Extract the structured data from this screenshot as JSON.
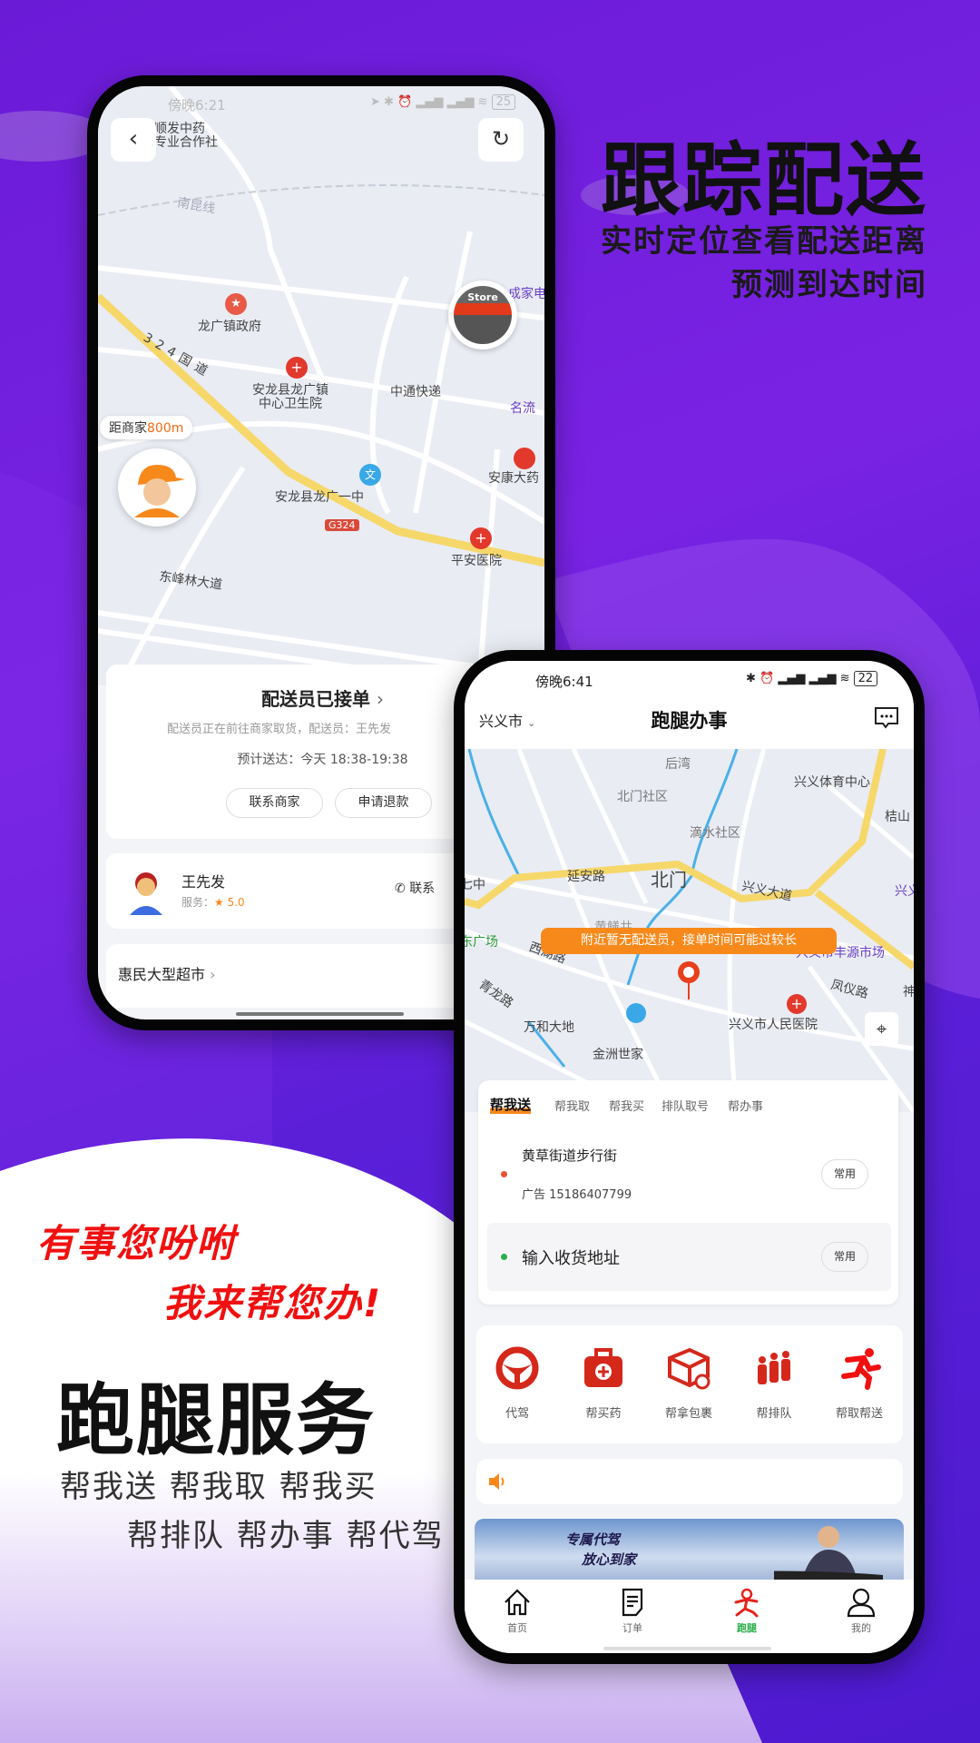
{
  "colors": {
    "brand_purple": "#6a1bd6",
    "accent_orange": "#f7891b",
    "red": "#e4231b",
    "green": "#2aae4a"
  },
  "promo": {
    "headline": "跟踪配送",
    "sub1": "实时定位查看配送距离",
    "sub2": "预测到达时间",
    "slogan1": "有事您吩咐",
    "slogan2": "我来帮您办!",
    "title": "跑腿服务",
    "services1": "帮我送 帮我取  帮我买",
    "services2": "帮排队 帮办事 帮代驾"
  },
  "phone1": {
    "status": {
      "time": "傍晚6:21",
      "battery": "25"
    },
    "map_labels": {
      "coop": "顺发中药\n专业合作社",
      "railway": "南昆线",
      "gov": "龙广镇政府",
      "elec": "成家电",
      "clinic": "安龙县龙广镇\n中心卫生院",
      "express": "中通快递",
      "mingliu": "名流",
      "pharmacy": "安康大药",
      "school": "安龙县龙广一中",
      "hwy": "G324",
      "hospital": "平安医院",
      "avenue": "东峰林大道",
      "road324": "324国道"
    },
    "distance_label": "距商家",
    "distance_value": "800m",
    "store_badge": "Store",
    "order": {
      "title": "配送员已接单",
      "subtitle": "配送员正在前往商家取货，配送员：王先发",
      "eta": "预计送达：今天 18:38-19:38",
      "contact_merchant": "联系商家",
      "refund": "申请退款"
    },
    "rider": {
      "name": "王先发",
      "service_label": "服务：",
      "rating": "5.0",
      "contact": "联系"
    },
    "store": {
      "name": "惠民大型超市"
    }
  },
  "phone2": {
    "status": {
      "time": "傍晚6:41",
      "battery": "22"
    },
    "header": {
      "city": "兴义市",
      "title": "跑腿办事"
    },
    "map_labels": {
      "houwan": "后湾",
      "beimen_sq": "北门社区",
      "dishui": "滴水社区",
      "tiyu": "兴义体育中心",
      "jieshan": "桔山",
      "yanan": "延安路",
      "beimen": "北门",
      "xydadao": "兴义大道",
      "qizhong": "七中",
      "dongguangchang": "东广场",
      "xihu": "西湖路",
      "qinglong": "青龙路",
      "wanhe": "万和大地",
      "jinzhou": "金洲世家",
      "hospital": "兴义市人民医院",
      "fengyi": "凤仪路",
      "market": "兴义市丰源市场",
      "shen": "神",
      "huangshan": "黄鳝井",
      "xy": "兴义"
    },
    "notice_banner": "附近暂无配送员，接单时间可能过较长",
    "tabs": [
      "帮我送",
      "帮我取",
      "帮我买",
      "排队取号",
      "帮办事"
    ],
    "active_tab": 0,
    "pickup": {
      "name": "黄草街道步行街",
      "contact": "广告 15186407799",
      "common": "常用"
    },
    "dropoff": {
      "placeholder": "输入收货地址",
      "common": "常用"
    },
    "services": [
      {
        "label": "代驾",
        "icon": "steering-wheel-icon"
      },
      {
        "label": "帮买药",
        "icon": "medical-kit-icon"
      },
      {
        "label": "帮拿包裹",
        "icon": "package-icon"
      },
      {
        "label": "帮排队",
        "icon": "queue-icon"
      },
      {
        "label": "帮取帮送",
        "icon": "runner-icon"
      }
    ],
    "ad": {
      "line1": "专属代驾",
      "line2": "放心到家"
    },
    "tabbar": [
      {
        "label": "首页",
        "icon": "home-icon"
      },
      {
        "label": "订单",
        "icon": "order-icon"
      },
      {
        "label": "跑腿",
        "icon": "runner-icon",
        "active": true
      },
      {
        "label": "我的",
        "icon": "user-icon"
      }
    ]
  }
}
